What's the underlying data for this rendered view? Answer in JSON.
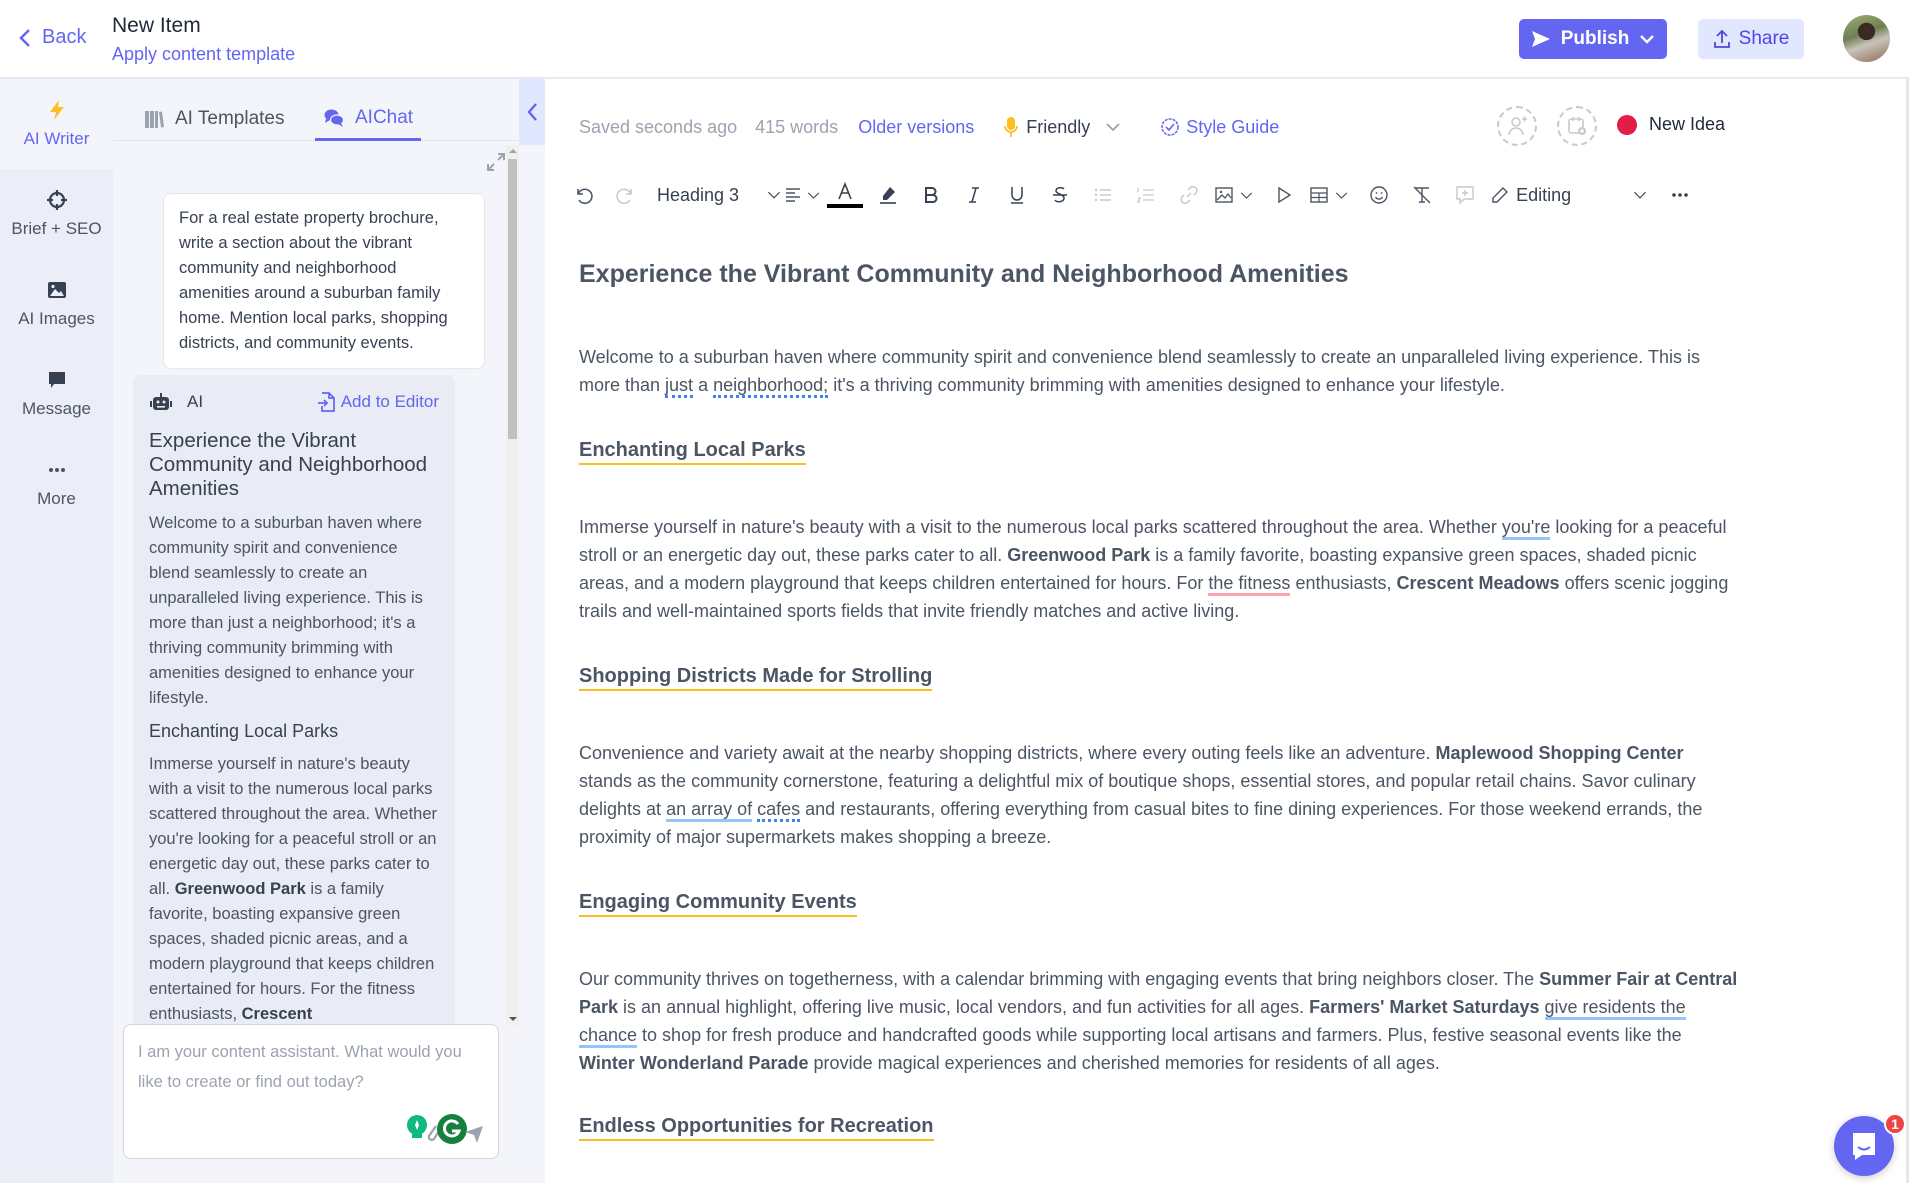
{
  "header": {
    "back_label": "Back",
    "title": "New Item",
    "subtitle": "Apply content template",
    "publish_label": "Publish",
    "share_label": "Share",
    "accent_color": "#6366f1"
  },
  "rail": {
    "items": [
      {
        "label": "AI Writer",
        "icon": "lightning-icon",
        "active": true
      },
      {
        "label": "Brief + SEO",
        "icon": "crosshair-icon"
      },
      {
        "label": "AI Images",
        "icon": "image-icon"
      },
      {
        "label": "Message",
        "icon": "message-icon"
      },
      {
        "label": "More",
        "icon": "more-icon"
      }
    ]
  },
  "panel": {
    "tabs": [
      {
        "label": "AI Templates",
        "icon": "books-icon"
      },
      {
        "label": "AIChat",
        "icon": "chat-icon",
        "active": true
      }
    ],
    "prompt": "For a real estate property brochure, write a section about the vibrant community and neighborhood amenities around a suburban family home. Mention local parks, shopping districts, and community events.",
    "ai_response": {
      "author": "AI",
      "add_to_editor_label": "Add to Editor",
      "title": "Experience the Vibrant Community and Neighborhood Amenities",
      "intro": "Welcome to a suburban haven where community spirit and convenience blend seamlessly to create an unparalleled living experience. This is more than just a neighborhood; it's a thriving community brimming with amenities designed to enhance your lifestyle.",
      "section_title": "Enchanting Local Parks",
      "section_p1": "Immerse yourself in nature's beauty with a visit to the numerous local parks scattered throughout the area. Whether you're looking for a peaceful stroll or an energetic day out, these parks cater to all. ",
      "section_b1": "Greenwood Park",
      "section_p2": " is a family favorite, boasting expansive green spaces, shaded picnic areas, and a modern playground that keeps children entertained for hours. For the fitness enthusiasts, ",
      "section_b2": "Crescent"
    },
    "input_placeholder": "I am your content assistant. What would you like to create or find out today?"
  },
  "editor": {
    "saved_status": "Saved seconds ago",
    "word_count": "415 words",
    "older_versions_label": "Older versions",
    "tone": "Friendly",
    "style_guide_label": "Style Guide",
    "status_label": "New Idea",
    "status_color": "#e11d48",
    "toolbar": {
      "block_style": "Heading 3",
      "mode": "Editing"
    },
    "document": {
      "h1": "Experience the Vibrant Community and Neighborhood Amenities",
      "intro": {
        "a": "Welcome to a suburban haven where community spirit and convenience blend seamlessly to create an unparalleled living experience. This is more than ",
        "u1": "just",
        "b": " a ",
        "u2": "neighborhood;",
        "c": " it's a thriving community brimming with amenities designed to enhance your lifestyle."
      },
      "parks": {
        "title": "Enchanting Local Parks",
        "a": "Immerse yourself in nature's beauty with a visit to the numerous local parks scattered throughout the area. Whether ",
        "u1": "you're",
        "b": " looking for a peaceful stroll or an energetic day out, these parks cater to all. ",
        "bold1": "Greenwood Park",
        "c": " is a family favorite, boasting expansive green spaces, shaded picnic areas, and a modern playground that keeps children entertained for hours. For ",
        "u2": "the fitness",
        "d": " enthusiasts, ",
        "bold2": "Crescent Meadows",
        "e": " offers scenic jogging trails and well-maintained sports fields that invite friendly matches and active living."
      },
      "shopping": {
        "title": "Shopping Districts Made for Strolling",
        "a": "Convenience and variety await at the nearby shopping districts, where every outing feels like an adventure. ",
        "bold1": "Maplewood Shopping Center",
        "b": " stands as the community cornerstone, featuring a delightful mix of boutique shops, essential stores, and popular retail chains. Savor culinary delights at ",
        "u1": "an array of",
        "c": " ",
        "u2": "cafes",
        "d": " and restaurants, offering everything from casual bites to fine dining experiences. For those weekend errands, the proximity of major supermarkets makes shopping a breeze."
      },
      "events": {
        "title": "Engaging Community Events",
        "a": "Our community thrives on togetherness, with a calendar brimming with engaging events that bring neighbors closer. The ",
        "bold1": "Summer Fair at Central Park",
        "b": " is an annual highlight, offering live music, local vendors, and fun activities for all ages. ",
        "bold2": "Farmers' Market Saturdays",
        "c": " ",
        "u1": "give residents the chance",
        "d": " to shop for fresh produce and handcrafted goods while supporting local artisans and farmers. Plus, festive seasonal events like the ",
        "bold3": "Winter Wonderland Parade",
        "e": " provide magical experiences and cherished memories for residents of all ages."
      },
      "recreation": {
        "title": "Endless Opportunities for Recreation"
      }
    }
  },
  "help": {
    "badge_count": "1"
  }
}
